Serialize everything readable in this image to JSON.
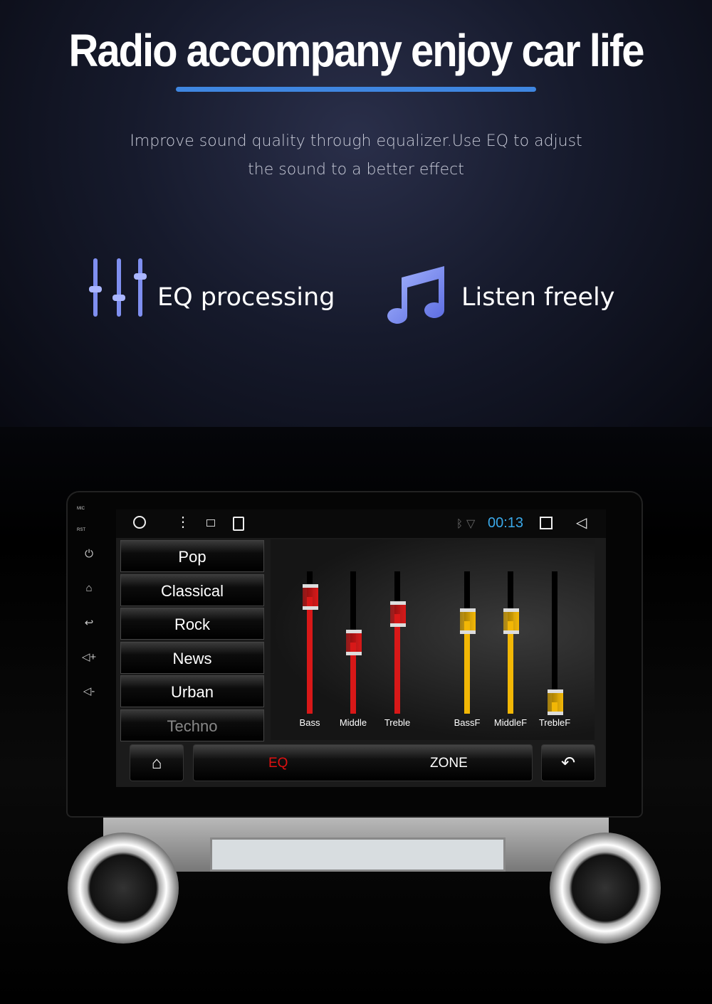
{
  "header": {
    "title": "Radio accompany enjoy car life",
    "subtitle_line1": "Improve sound quality through equalizer.Use EQ to adjust",
    "subtitle_line2": "the sound to a better effect",
    "accent": "#3f86e0"
  },
  "features": [
    {
      "icon": "equalizer-icon",
      "label": "EQ processing"
    },
    {
      "icon": "music-note-icon",
      "label": "Listen freely"
    }
  ],
  "side_buttons": {
    "mic": "MIC",
    "rst": "RST",
    "icons": [
      "power-icon",
      "home-icon",
      "back-icon",
      "volume-up-icon",
      "volume-down-icon"
    ]
  },
  "status_bar": {
    "time": "00:13",
    "icons": [
      "circle-icon",
      "menu-dots-icon",
      "image-icon",
      "sd-card-icon",
      "bluetooth-icon",
      "wifi-icon",
      "recents-icon",
      "back-triangle-icon"
    ]
  },
  "presets": [
    {
      "label": "Pop"
    },
    {
      "label": "Classical"
    },
    {
      "label": "Rock"
    },
    {
      "label": "News"
    },
    {
      "label": "Urban"
    },
    {
      "label": "Techno",
      "dimmed": true
    }
  ],
  "sliders": [
    {
      "label": "Bass",
      "level": 0.82,
      "color": "#d81818"
    },
    {
      "label": "Middle",
      "level": 0.5,
      "color": "#d81818"
    },
    {
      "label": "Treble",
      "level": 0.7,
      "color": "#d81818"
    },
    {
      "label": "BassF",
      "level": 0.65,
      "color": "#f2b705"
    },
    {
      "label": "MiddleF",
      "level": 0.65,
      "color": "#f2b705"
    },
    {
      "label": "TrebleF",
      "level": 0.08,
      "color": "#f2b705"
    }
  ],
  "bottom_bar": {
    "eq": "EQ",
    "zone": "ZONE",
    "eq_color": "#e01010"
  }
}
